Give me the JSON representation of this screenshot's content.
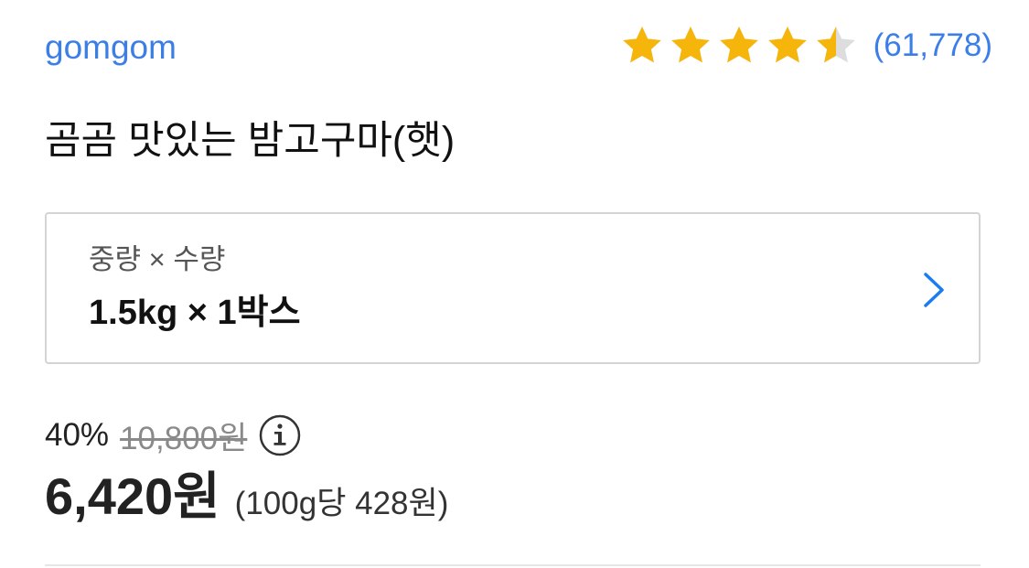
{
  "brand": {
    "name": "gomgom"
  },
  "rating": {
    "value": 4.5,
    "max": 5,
    "review_count": "(61,778)",
    "star_color": "#f5b50a",
    "empty_star_color": "#dddddd"
  },
  "product": {
    "title": "곰곰 맛있는 밤고구마(햇)"
  },
  "option": {
    "label": "중량 × 수량",
    "value": "1.5kg × 1박스",
    "chevron_icon": "chevron-right-icon",
    "chevron_color": "#1a7cf0"
  },
  "price": {
    "discount": "40%",
    "original": "10,800원",
    "info_icon": "info-icon",
    "sale": "6,420원",
    "unit_price": "(100g당 428원)"
  },
  "colors": {
    "link": "#3b7ee8",
    "border": "#d4d4d4"
  }
}
